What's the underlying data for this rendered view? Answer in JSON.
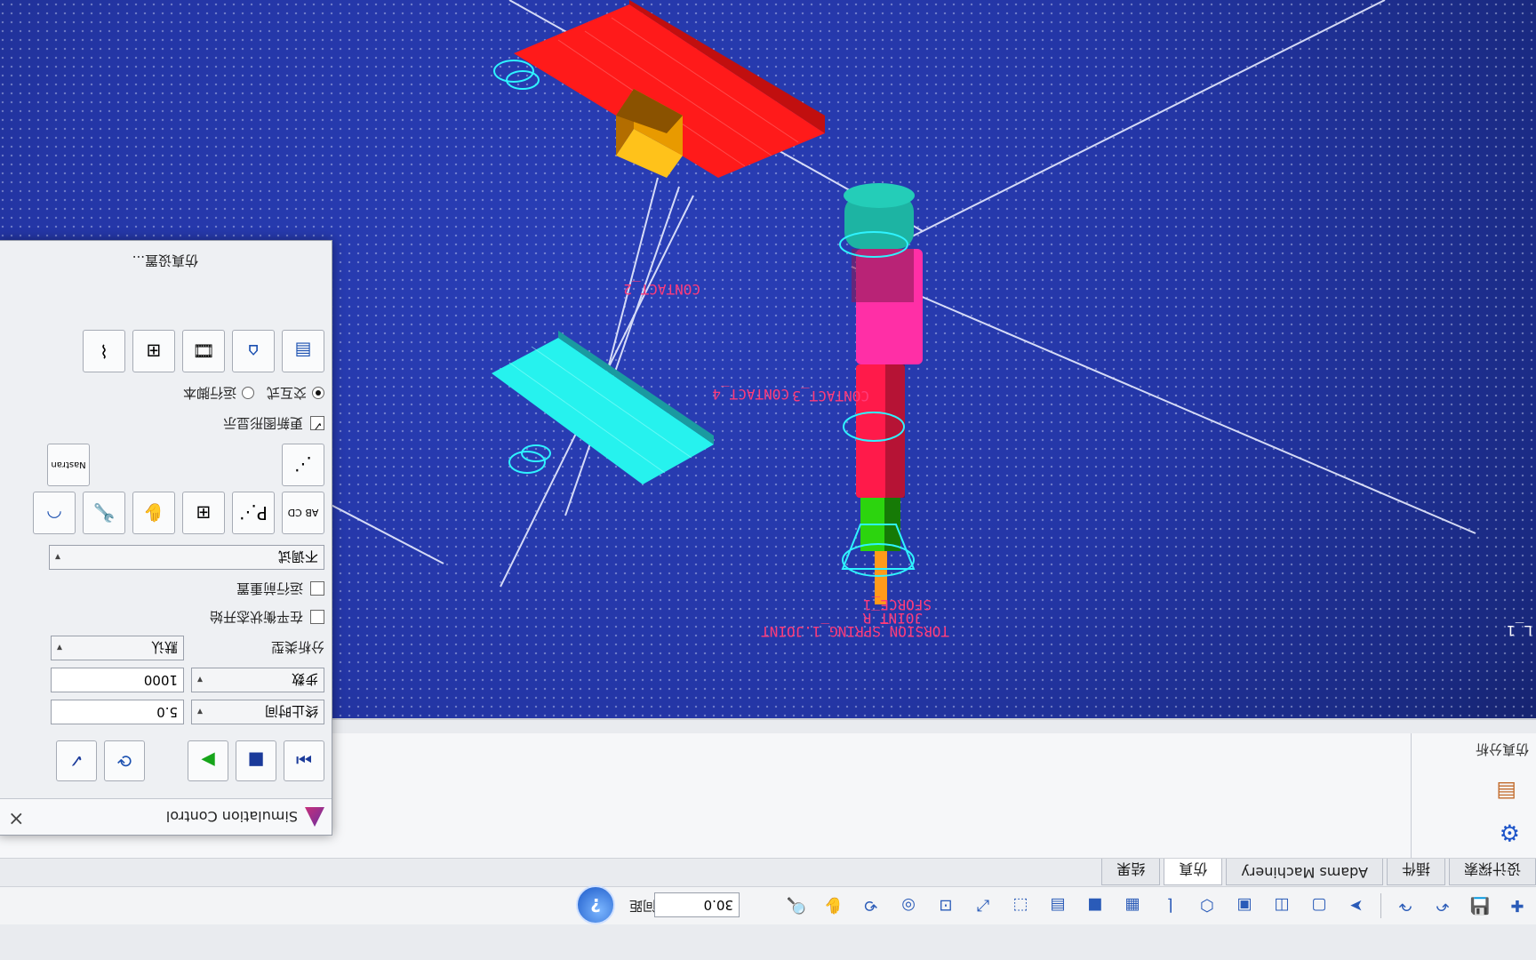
{
  "screen": {
    "rotated_180": true
  },
  "ribbon": {
    "tabs": [
      {
        "label": "设计探索"
      },
      {
        "label": "插件"
      },
      {
        "label": "Adams Machinery"
      },
      {
        "label": "仿真"
      },
      {
        "label": "结果"
      }
    ],
    "active_tab": "仿真",
    "panel_title": "仿真分析",
    "zoom_label": "间距",
    "zoom_value": "30.0",
    "help_label": "?"
  },
  "dialog": {
    "title": "Simulation Control",
    "close": "×",
    "end_time_label": "终止时间",
    "end_time_value": "5.0",
    "steps_label": "步数",
    "steps_value": "1000",
    "analysis_type_label": "分析类型",
    "analysis_type_value": "默认",
    "checkbox_start_equilibrium": "在平衡状态开始",
    "checkbox_reset_before_run": "运行前重置",
    "debug_value": "不调试",
    "checkbox_update_graphics": "更新图形显示",
    "radio_interactive": "交互式",
    "radio_script": "运行脚本",
    "settings_link": "仿真设置...",
    "icon_ab_label": "AB CD",
    "icon_nastran_label": "Nastran"
  },
  "scene": {
    "labels": {
      "contact2": "CONTACT_2",
      "contact4": "CONTACT_4",
      "contact3": "CONTACT_3",
      "sforce": "SFORCE_1",
      "torsion": "TORSION_SPRING_1.JOINT",
      "joint_r": "JOINT_R",
      "left_edge": "L_1"
    },
    "colors": {
      "red": "#ff1a1a",
      "orange": "#ffb300",
      "cyan": "#26f2ee",
      "pink": "#ff2fa6",
      "teal": "#1db4a3",
      "green": "#2cd40e"
    }
  }
}
